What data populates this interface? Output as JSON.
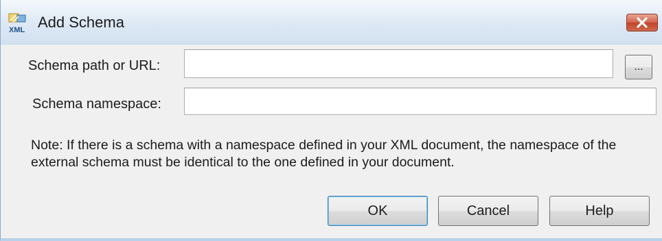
{
  "window": {
    "title": "Add Schema",
    "icon": "xml-schema-icon",
    "close_icon": "close-icon",
    "close_color": "#c9462c"
  },
  "form": {
    "schema_path_label": "Schema path or URL:",
    "schema_path_value": "",
    "browse_label": "...",
    "schema_namespace_label": "Schema namespace:",
    "schema_namespace_value": ""
  },
  "note": "Note: If there is a schema with a namespace defined in your XML document, the namespace of the external schema must be identical to the one defined in your document.",
  "buttons": {
    "ok": "OK",
    "cancel": "Cancel",
    "help": "Help"
  },
  "colors": {
    "titlebar": "#dde8f4",
    "dialog_background": "#f0f0f0",
    "default_button_border": "#3c7fb1"
  }
}
